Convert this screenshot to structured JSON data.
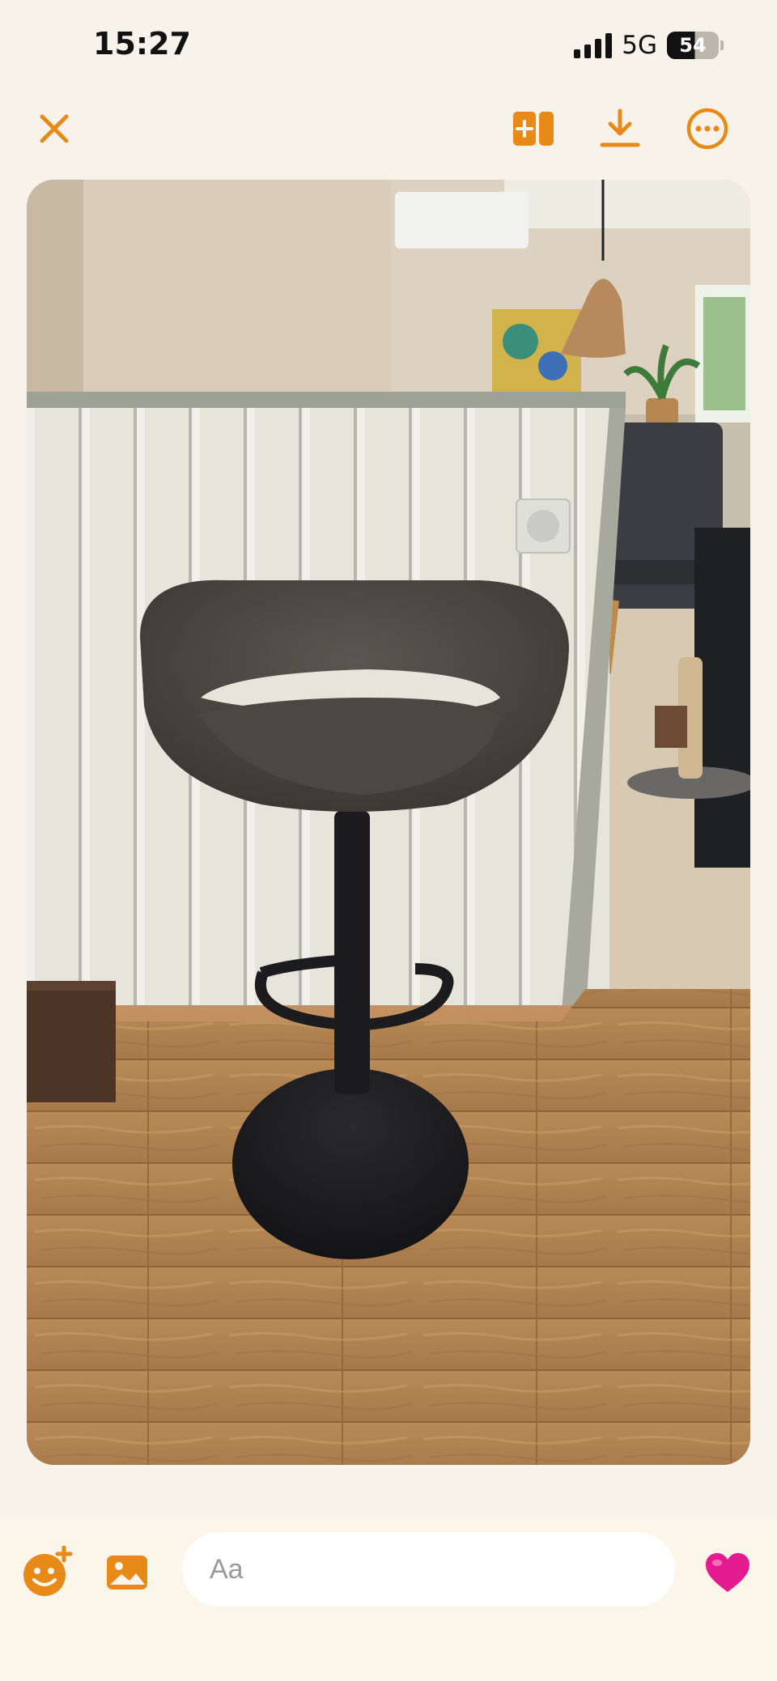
{
  "status_bar": {
    "time": "15:27",
    "network": "5G",
    "battery": "54"
  },
  "toolbar": {
    "icons": [
      "close-icon",
      "split-add-icon",
      "download-icon",
      "more-icon"
    ]
  },
  "composer": {
    "placeholder": "Aa",
    "icons": [
      "emoji-add-icon",
      "image-icon",
      "heart-icon"
    ]
  },
  "colors": {
    "accent": "#e88a17",
    "background": "#f8f3ea",
    "heart": "#e51c8f"
  }
}
